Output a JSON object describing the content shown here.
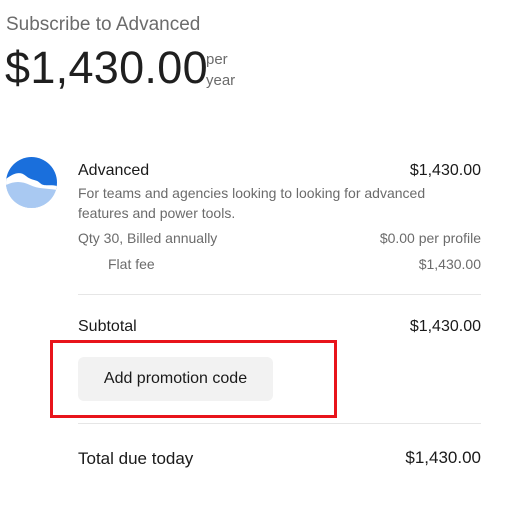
{
  "header": {
    "title": "Subscribe to Advanced",
    "price": "$1,430.00",
    "period_line1": "per",
    "period_line2": "year"
  },
  "product": {
    "icon": "product-logo-icon",
    "name": "Advanced",
    "price": "$1,430.00",
    "description": "For teams and agencies looking to looking for advanced features and power tools.",
    "quantity_label": "Qty 30, Billed annually",
    "quantity_price": "$0.00 per profile",
    "fee_label": "Flat fee",
    "fee_price": "$1,430.00"
  },
  "summary": {
    "subtotal_label": "Subtotal",
    "subtotal_value": "$1,430.00",
    "promo_button_label": "Add promotion code",
    "total_label": "Total due today",
    "total_value": "$1,430.00"
  },
  "colors": {
    "highlight_border": "#e8141b",
    "icon_blue": "#1a6fdc",
    "icon_light": "#a9c9f2"
  }
}
